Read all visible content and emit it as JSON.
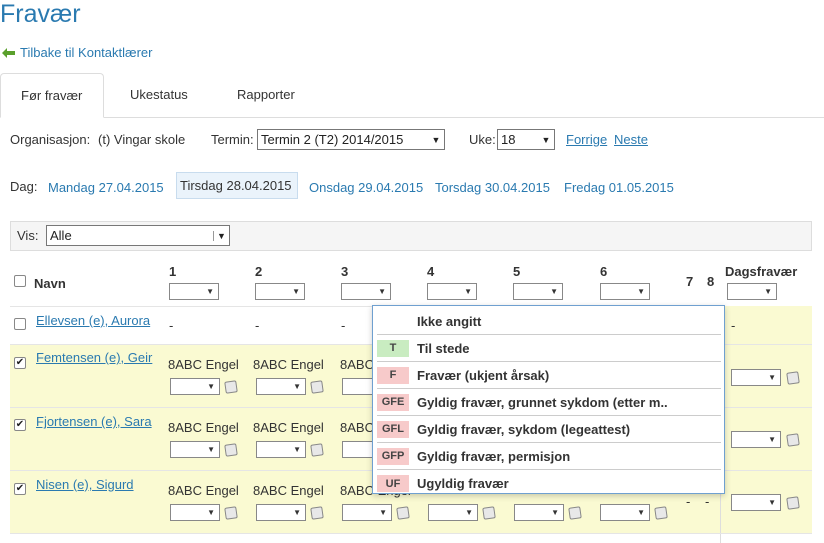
{
  "page_title": "Fravær",
  "back_link": "Tilbake til Kontaktlærer",
  "tabs": [
    "Før fravær",
    "Ukestatus",
    "Rapporter"
  ],
  "filters": {
    "org_label": "Organisasjon:",
    "org_value": "(t) Vingar skole",
    "term_label": "Termin:",
    "term_value": "Termin 2 (T2) 2014/2015",
    "week_label": "Uke:",
    "week_value": "18",
    "prev": "Forrige",
    "next": "Neste"
  },
  "days": {
    "label": "Dag:",
    "items": [
      "Mandag 27.04.2015",
      "Tirsdag 28.04.2015",
      "Onsdag 29.04.2015",
      "Torsdag 30.04.2015",
      "Fredag 01.05.2015"
    ],
    "selected_index": 1
  },
  "show": {
    "label": "Vis:",
    "value": "Alle"
  },
  "table": {
    "name_header": "Navn",
    "period_headers": [
      "1",
      "2",
      "3",
      "4",
      "5",
      "6",
      "7",
      "8"
    ],
    "day_header": "Dagsfravær",
    "rows": [
      {
        "name": "Ellevsen (e), Aurora",
        "checked": false,
        "dash": "-"
      },
      {
        "name": "Femtensen (e), Geir",
        "checked": true,
        "lesson": "8ABC Engel"
      },
      {
        "name": "Fjortensen (e), Sara",
        "checked": true,
        "lesson": "8ABC Engel"
      },
      {
        "name": "Nisen (e), Sigurd",
        "checked": true,
        "lesson": "8ABC Engel"
      }
    ]
  },
  "dropdown": {
    "options": [
      {
        "code": "",
        "label": "Ikke angitt",
        "color": ""
      },
      {
        "code": "T",
        "label": "Til stede",
        "color": "#c9ecc1"
      },
      {
        "code": "F",
        "label": "Fravær (ukjent årsak)",
        "color": "#f7caca"
      },
      {
        "code": "GFE",
        "label": "Gyldig fravær, grunnet sykdom (etter m..",
        "color": "#f7caca"
      },
      {
        "code": "GFL",
        "label": "Gyldig fravær, sykdom (legeattest)",
        "color": "#f7caca"
      },
      {
        "code": "GFP",
        "label": "Gyldig fravær, permisjon",
        "color": "#f7caca"
      },
      {
        "code": "UF",
        "label": "Ugyldig fravær",
        "color": "#f7caca"
      }
    ]
  }
}
